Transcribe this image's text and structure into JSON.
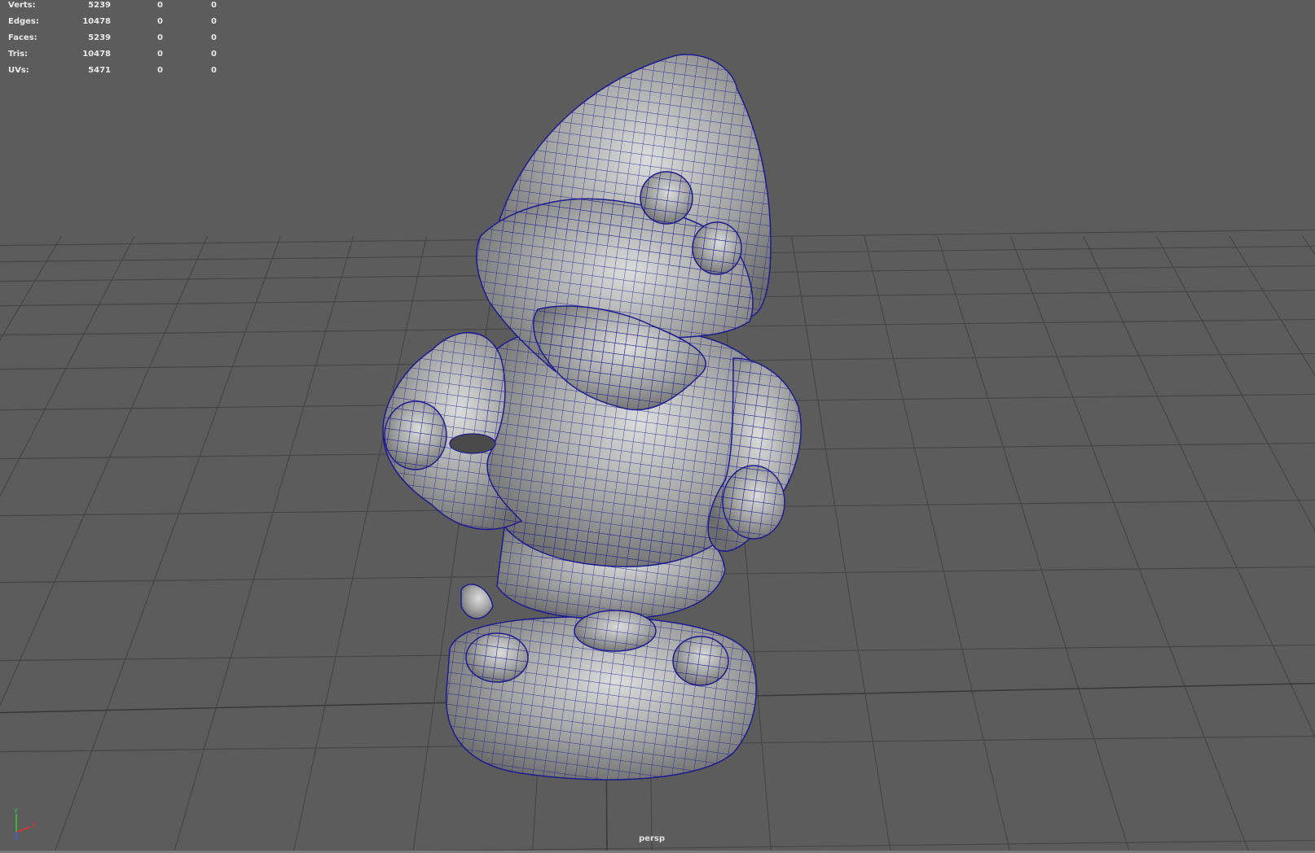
{
  "hud": {
    "rows": [
      {
        "label": "Verts:",
        "values": [
          "5239",
          "0",
          "0"
        ]
      },
      {
        "label": "Edges:",
        "values": [
          "10478",
          "0",
          "0"
        ]
      },
      {
        "label": "Faces:",
        "values": [
          "5239",
          "0",
          "0"
        ]
      },
      {
        "label": "Tris:",
        "values": [
          "10478",
          "0",
          "0"
        ]
      },
      {
        "label": "UVs:",
        "values": [
          "5471",
          "0",
          "0"
        ]
      }
    ]
  },
  "viewport": {
    "camera": "persp",
    "background_color": "#5c5c5c",
    "grid_color": "#464646",
    "wireframe_color": "#1a1a8c",
    "mesh_color": "#9a9a9a"
  },
  "axis_gizmo": {
    "x_label": "X",
    "y_label": "Y",
    "z_label": "Z",
    "x_color": "#e03030",
    "y_color": "#30d030",
    "z_color": "#3060ff"
  }
}
